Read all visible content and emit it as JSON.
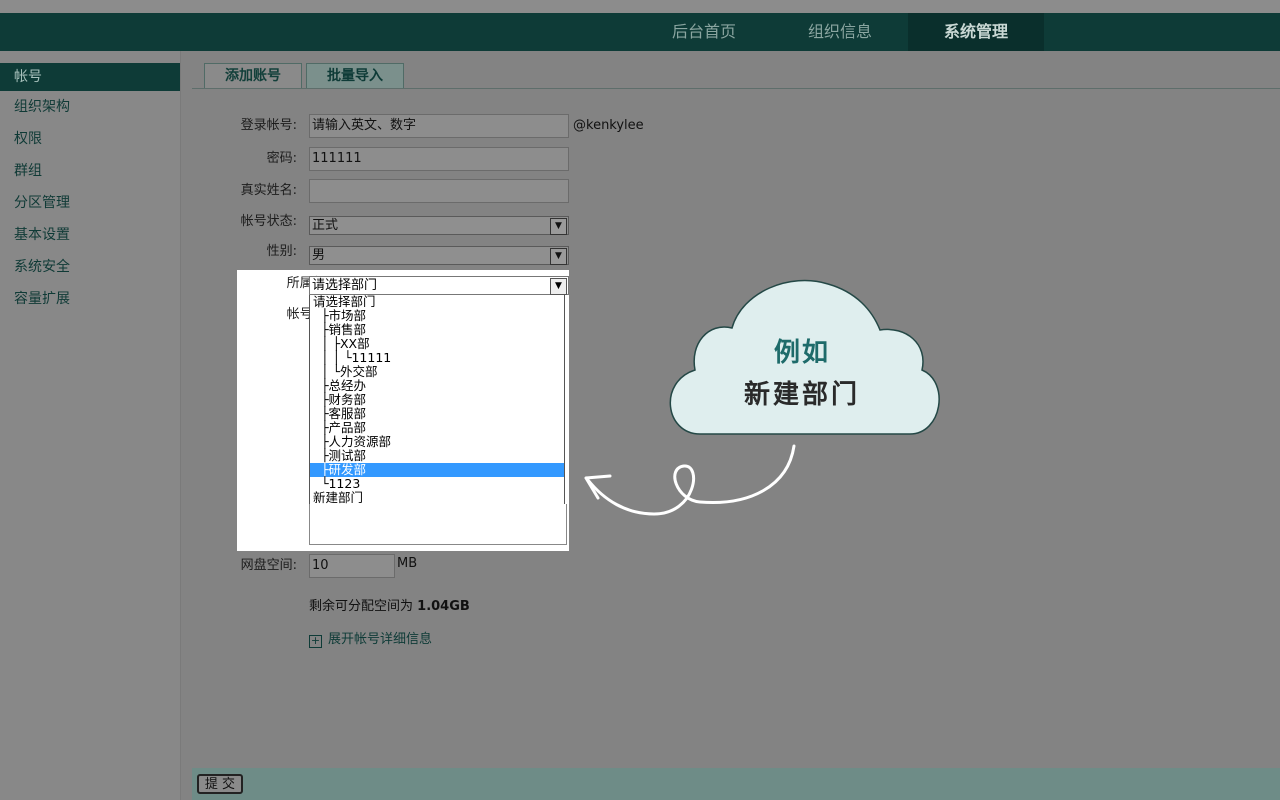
{
  "nav": {
    "items": [
      "后台首页",
      "组织信息",
      "系统管理"
    ],
    "active_index": 2
  },
  "sidebar": {
    "items": [
      "帐号",
      "组织架构",
      "权限",
      "群组",
      "分区管理",
      "基本设置",
      "系统安全",
      "容量扩展"
    ]
  },
  "tabs": [
    "添加账号",
    "批量导入"
  ],
  "form": {
    "login_label": "登录帐号:",
    "login_placeholder": "请输入英文、数字",
    "domain_suffix": "@kenkylee",
    "password_label": "密码:",
    "password_value": "111111",
    "realname_label": "真实姓名:",
    "realname_value": "",
    "status_label": "帐号状态:",
    "status_value": "正式",
    "gender_label": "性别:",
    "gender_value": "男",
    "dept_label": "所属部门:",
    "dept_value": "请选择部门",
    "perm_label": "帐号权限:",
    "disk_label": "网盘空间:",
    "disk_value": "10",
    "disk_unit": "MB",
    "quota_prefix": "剩余可分配空间为",
    "quota_value": "1.04GB",
    "expand_label": "展开帐号详细信息"
  },
  "dept_options": [
    "请选择部门",
    "  ├市场部",
    "  ├销售部",
    "  │ ├XX部",
    "  │ │ └11111",
    "  │ └外交部",
    "  ├总经办",
    "  ├财务部",
    "  ├客服部",
    "  ├产品部",
    "  ├人力资源部",
    "  ├测试部",
    "  ├研发部",
    "  └1123",
    "新建部门"
  ],
  "dept_selected_index": 12,
  "footer": {
    "submit_label": "提 交"
  },
  "callout": {
    "line1": "例如",
    "line2": "新建部门"
  },
  "colors": {
    "topbar": "#0e3b37",
    "highlight": "#3399ff",
    "cloud_fill": "#dfeeee",
    "cloud_text": "#1e6b6a"
  }
}
